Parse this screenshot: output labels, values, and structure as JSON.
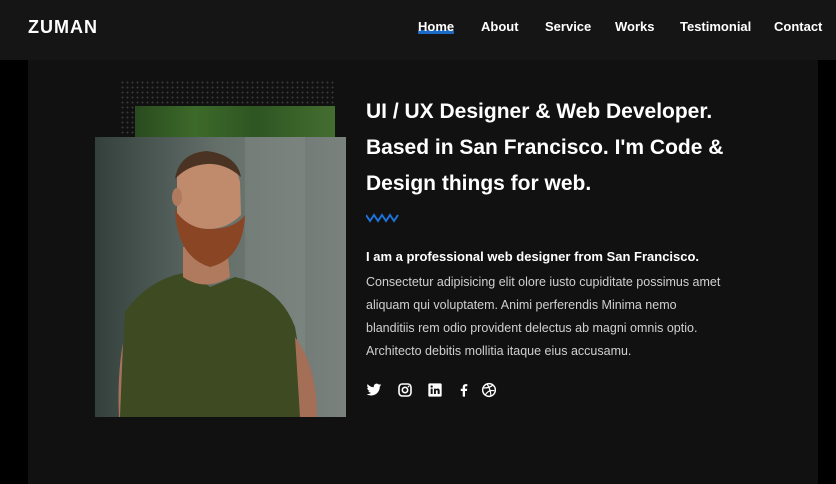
{
  "brand": {
    "logo_text": "ZUMAN"
  },
  "nav": {
    "items": [
      {
        "label": "Home",
        "active": true
      },
      {
        "label": "About",
        "active": false
      },
      {
        "label": "Service",
        "active": false
      },
      {
        "label": "Works",
        "active": false
      },
      {
        "label": "Testimonial",
        "active": false
      },
      {
        "label": "Contact",
        "active": false
      }
    ]
  },
  "hero": {
    "headline_lines": [
      "UI / UX Designer & Web Developer.",
      "Based in San Francisco. I'm Code &",
      "Design things for web."
    ],
    "subhead": "I am a professional web designer from San Francisco.",
    "body_lines": [
      "Consectetur adipisicing elit olore iusto cupiditate possimus amet",
      "aliquam qui voluptatem. Animi perferendis Minima nemo",
      "blanditiis rem odio provident delectus ab magni omnis optio.",
      "Architecto debitis mollitia itaque eius accusamu."
    ]
  },
  "social": [
    "twitter-icon",
    "instagram-icon",
    "linkedin-icon",
    "facebook-icon",
    "dribbble-icon"
  ],
  "colors": {
    "accent": "#1e73d8",
    "topbar": "#151515",
    "panel": "#111111",
    "background": "#000000"
  }
}
